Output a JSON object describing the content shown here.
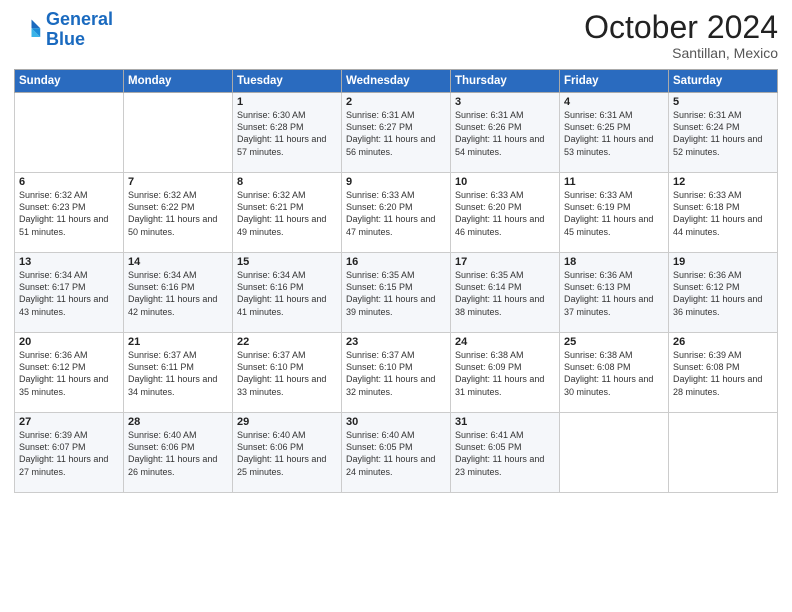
{
  "logo": {
    "line1": "General",
    "line2": "Blue"
  },
  "title": "October 2024",
  "subtitle": "Santillan, Mexico",
  "header_days": [
    "Sunday",
    "Monday",
    "Tuesday",
    "Wednesday",
    "Thursday",
    "Friday",
    "Saturday"
  ],
  "weeks": [
    [
      {
        "day": "",
        "sunrise": "",
        "sunset": "",
        "daylight": ""
      },
      {
        "day": "",
        "sunrise": "",
        "sunset": "",
        "daylight": ""
      },
      {
        "day": "1",
        "sunrise": "Sunrise: 6:30 AM",
        "sunset": "Sunset: 6:28 PM",
        "daylight": "Daylight: 11 hours and 57 minutes."
      },
      {
        "day": "2",
        "sunrise": "Sunrise: 6:31 AM",
        "sunset": "Sunset: 6:27 PM",
        "daylight": "Daylight: 11 hours and 56 minutes."
      },
      {
        "day": "3",
        "sunrise": "Sunrise: 6:31 AM",
        "sunset": "Sunset: 6:26 PM",
        "daylight": "Daylight: 11 hours and 54 minutes."
      },
      {
        "day": "4",
        "sunrise": "Sunrise: 6:31 AM",
        "sunset": "Sunset: 6:25 PM",
        "daylight": "Daylight: 11 hours and 53 minutes."
      },
      {
        "day": "5",
        "sunrise": "Sunrise: 6:31 AM",
        "sunset": "Sunset: 6:24 PM",
        "daylight": "Daylight: 11 hours and 52 minutes."
      }
    ],
    [
      {
        "day": "6",
        "sunrise": "Sunrise: 6:32 AM",
        "sunset": "Sunset: 6:23 PM",
        "daylight": "Daylight: 11 hours and 51 minutes."
      },
      {
        "day": "7",
        "sunrise": "Sunrise: 6:32 AM",
        "sunset": "Sunset: 6:22 PM",
        "daylight": "Daylight: 11 hours and 50 minutes."
      },
      {
        "day": "8",
        "sunrise": "Sunrise: 6:32 AM",
        "sunset": "Sunset: 6:21 PM",
        "daylight": "Daylight: 11 hours and 49 minutes."
      },
      {
        "day": "9",
        "sunrise": "Sunrise: 6:33 AM",
        "sunset": "Sunset: 6:20 PM",
        "daylight": "Daylight: 11 hours and 47 minutes."
      },
      {
        "day": "10",
        "sunrise": "Sunrise: 6:33 AM",
        "sunset": "Sunset: 6:20 PM",
        "daylight": "Daylight: 11 hours and 46 minutes."
      },
      {
        "day": "11",
        "sunrise": "Sunrise: 6:33 AM",
        "sunset": "Sunset: 6:19 PM",
        "daylight": "Daylight: 11 hours and 45 minutes."
      },
      {
        "day": "12",
        "sunrise": "Sunrise: 6:33 AM",
        "sunset": "Sunset: 6:18 PM",
        "daylight": "Daylight: 11 hours and 44 minutes."
      }
    ],
    [
      {
        "day": "13",
        "sunrise": "Sunrise: 6:34 AM",
        "sunset": "Sunset: 6:17 PM",
        "daylight": "Daylight: 11 hours and 43 minutes."
      },
      {
        "day": "14",
        "sunrise": "Sunrise: 6:34 AM",
        "sunset": "Sunset: 6:16 PM",
        "daylight": "Daylight: 11 hours and 42 minutes."
      },
      {
        "day": "15",
        "sunrise": "Sunrise: 6:34 AM",
        "sunset": "Sunset: 6:16 PM",
        "daylight": "Daylight: 11 hours and 41 minutes."
      },
      {
        "day": "16",
        "sunrise": "Sunrise: 6:35 AM",
        "sunset": "Sunset: 6:15 PM",
        "daylight": "Daylight: 11 hours and 39 minutes."
      },
      {
        "day": "17",
        "sunrise": "Sunrise: 6:35 AM",
        "sunset": "Sunset: 6:14 PM",
        "daylight": "Daylight: 11 hours and 38 minutes."
      },
      {
        "day": "18",
        "sunrise": "Sunrise: 6:36 AM",
        "sunset": "Sunset: 6:13 PM",
        "daylight": "Daylight: 11 hours and 37 minutes."
      },
      {
        "day": "19",
        "sunrise": "Sunrise: 6:36 AM",
        "sunset": "Sunset: 6:12 PM",
        "daylight": "Daylight: 11 hours and 36 minutes."
      }
    ],
    [
      {
        "day": "20",
        "sunrise": "Sunrise: 6:36 AM",
        "sunset": "Sunset: 6:12 PM",
        "daylight": "Daylight: 11 hours and 35 minutes."
      },
      {
        "day": "21",
        "sunrise": "Sunrise: 6:37 AM",
        "sunset": "Sunset: 6:11 PM",
        "daylight": "Daylight: 11 hours and 34 minutes."
      },
      {
        "day": "22",
        "sunrise": "Sunrise: 6:37 AM",
        "sunset": "Sunset: 6:10 PM",
        "daylight": "Daylight: 11 hours and 33 minutes."
      },
      {
        "day": "23",
        "sunrise": "Sunrise: 6:37 AM",
        "sunset": "Sunset: 6:10 PM",
        "daylight": "Daylight: 11 hours and 32 minutes."
      },
      {
        "day": "24",
        "sunrise": "Sunrise: 6:38 AM",
        "sunset": "Sunset: 6:09 PM",
        "daylight": "Daylight: 11 hours and 31 minutes."
      },
      {
        "day": "25",
        "sunrise": "Sunrise: 6:38 AM",
        "sunset": "Sunset: 6:08 PM",
        "daylight": "Daylight: 11 hours and 30 minutes."
      },
      {
        "day": "26",
        "sunrise": "Sunrise: 6:39 AM",
        "sunset": "Sunset: 6:08 PM",
        "daylight": "Daylight: 11 hours and 28 minutes."
      }
    ],
    [
      {
        "day": "27",
        "sunrise": "Sunrise: 6:39 AM",
        "sunset": "Sunset: 6:07 PM",
        "daylight": "Daylight: 11 hours and 27 minutes."
      },
      {
        "day": "28",
        "sunrise": "Sunrise: 6:40 AM",
        "sunset": "Sunset: 6:06 PM",
        "daylight": "Daylight: 11 hours and 26 minutes."
      },
      {
        "day": "29",
        "sunrise": "Sunrise: 6:40 AM",
        "sunset": "Sunset: 6:06 PM",
        "daylight": "Daylight: 11 hours and 25 minutes."
      },
      {
        "day": "30",
        "sunrise": "Sunrise: 6:40 AM",
        "sunset": "Sunset: 6:05 PM",
        "daylight": "Daylight: 11 hours and 24 minutes."
      },
      {
        "day": "31",
        "sunrise": "Sunrise: 6:41 AM",
        "sunset": "Sunset: 6:05 PM",
        "daylight": "Daylight: 11 hours and 23 minutes."
      },
      {
        "day": "",
        "sunrise": "",
        "sunset": "",
        "daylight": ""
      },
      {
        "day": "",
        "sunrise": "",
        "sunset": "",
        "daylight": ""
      }
    ]
  ]
}
